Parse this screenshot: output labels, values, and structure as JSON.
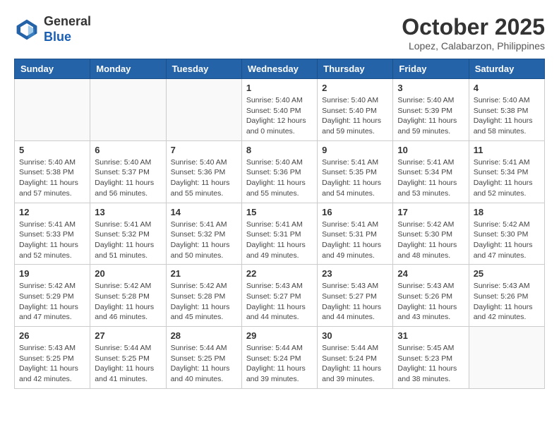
{
  "header": {
    "logo_line1": "General",
    "logo_line2": "Blue",
    "month": "October 2025",
    "location": "Lopez, Calabarzon, Philippines"
  },
  "weekdays": [
    "Sunday",
    "Monday",
    "Tuesday",
    "Wednesday",
    "Thursday",
    "Friday",
    "Saturday"
  ],
  "weeks": [
    [
      {
        "day": "",
        "info": ""
      },
      {
        "day": "",
        "info": ""
      },
      {
        "day": "",
        "info": ""
      },
      {
        "day": "1",
        "info": "Sunrise: 5:40 AM\nSunset: 5:40 PM\nDaylight: 12 hours\nand 0 minutes."
      },
      {
        "day": "2",
        "info": "Sunrise: 5:40 AM\nSunset: 5:40 PM\nDaylight: 11 hours\nand 59 minutes."
      },
      {
        "day": "3",
        "info": "Sunrise: 5:40 AM\nSunset: 5:39 PM\nDaylight: 11 hours\nand 59 minutes."
      },
      {
        "day": "4",
        "info": "Sunrise: 5:40 AM\nSunset: 5:38 PM\nDaylight: 11 hours\nand 58 minutes."
      }
    ],
    [
      {
        "day": "5",
        "info": "Sunrise: 5:40 AM\nSunset: 5:38 PM\nDaylight: 11 hours\nand 57 minutes."
      },
      {
        "day": "6",
        "info": "Sunrise: 5:40 AM\nSunset: 5:37 PM\nDaylight: 11 hours\nand 56 minutes."
      },
      {
        "day": "7",
        "info": "Sunrise: 5:40 AM\nSunset: 5:36 PM\nDaylight: 11 hours\nand 55 minutes."
      },
      {
        "day": "8",
        "info": "Sunrise: 5:40 AM\nSunset: 5:36 PM\nDaylight: 11 hours\nand 55 minutes."
      },
      {
        "day": "9",
        "info": "Sunrise: 5:41 AM\nSunset: 5:35 PM\nDaylight: 11 hours\nand 54 minutes."
      },
      {
        "day": "10",
        "info": "Sunrise: 5:41 AM\nSunset: 5:34 PM\nDaylight: 11 hours\nand 53 minutes."
      },
      {
        "day": "11",
        "info": "Sunrise: 5:41 AM\nSunset: 5:34 PM\nDaylight: 11 hours\nand 52 minutes."
      }
    ],
    [
      {
        "day": "12",
        "info": "Sunrise: 5:41 AM\nSunset: 5:33 PM\nDaylight: 11 hours\nand 52 minutes."
      },
      {
        "day": "13",
        "info": "Sunrise: 5:41 AM\nSunset: 5:32 PM\nDaylight: 11 hours\nand 51 minutes."
      },
      {
        "day": "14",
        "info": "Sunrise: 5:41 AM\nSunset: 5:32 PM\nDaylight: 11 hours\nand 50 minutes."
      },
      {
        "day": "15",
        "info": "Sunrise: 5:41 AM\nSunset: 5:31 PM\nDaylight: 11 hours\nand 49 minutes."
      },
      {
        "day": "16",
        "info": "Sunrise: 5:41 AM\nSunset: 5:31 PM\nDaylight: 11 hours\nand 49 minutes."
      },
      {
        "day": "17",
        "info": "Sunrise: 5:42 AM\nSunset: 5:30 PM\nDaylight: 11 hours\nand 48 minutes."
      },
      {
        "day": "18",
        "info": "Sunrise: 5:42 AM\nSunset: 5:30 PM\nDaylight: 11 hours\nand 47 minutes."
      }
    ],
    [
      {
        "day": "19",
        "info": "Sunrise: 5:42 AM\nSunset: 5:29 PM\nDaylight: 11 hours\nand 47 minutes."
      },
      {
        "day": "20",
        "info": "Sunrise: 5:42 AM\nSunset: 5:28 PM\nDaylight: 11 hours\nand 46 minutes."
      },
      {
        "day": "21",
        "info": "Sunrise: 5:42 AM\nSunset: 5:28 PM\nDaylight: 11 hours\nand 45 minutes."
      },
      {
        "day": "22",
        "info": "Sunrise: 5:43 AM\nSunset: 5:27 PM\nDaylight: 11 hours\nand 44 minutes."
      },
      {
        "day": "23",
        "info": "Sunrise: 5:43 AM\nSunset: 5:27 PM\nDaylight: 11 hours\nand 44 minutes."
      },
      {
        "day": "24",
        "info": "Sunrise: 5:43 AM\nSunset: 5:26 PM\nDaylight: 11 hours\nand 43 minutes."
      },
      {
        "day": "25",
        "info": "Sunrise: 5:43 AM\nSunset: 5:26 PM\nDaylight: 11 hours\nand 42 minutes."
      }
    ],
    [
      {
        "day": "26",
        "info": "Sunrise: 5:43 AM\nSunset: 5:25 PM\nDaylight: 11 hours\nand 42 minutes."
      },
      {
        "day": "27",
        "info": "Sunrise: 5:44 AM\nSunset: 5:25 PM\nDaylight: 11 hours\nand 41 minutes."
      },
      {
        "day": "28",
        "info": "Sunrise: 5:44 AM\nSunset: 5:25 PM\nDaylight: 11 hours\nand 40 minutes."
      },
      {
        "day": "29",
        "info": "Sunrise: 5:44 AM\nSunset: 5:24 PM\nDaylight: 11 hours\nand 39 minutes."
      },
      {
        "day": "30",
        "info": "Sunrise: 5:44 AM\nSunset: 5:24 PM\nDaylight: 11 hours\nand 39 minutes."
      },
      {
        "day": "31",
        "info": "Sunrise: 5:45 AM\nSunset: 5:23 PM\nDaylight: 11 hours\nand 38 minutes."
      },
      {
        "day": "",
        "info": ""
      }
    ]
  ]
}
